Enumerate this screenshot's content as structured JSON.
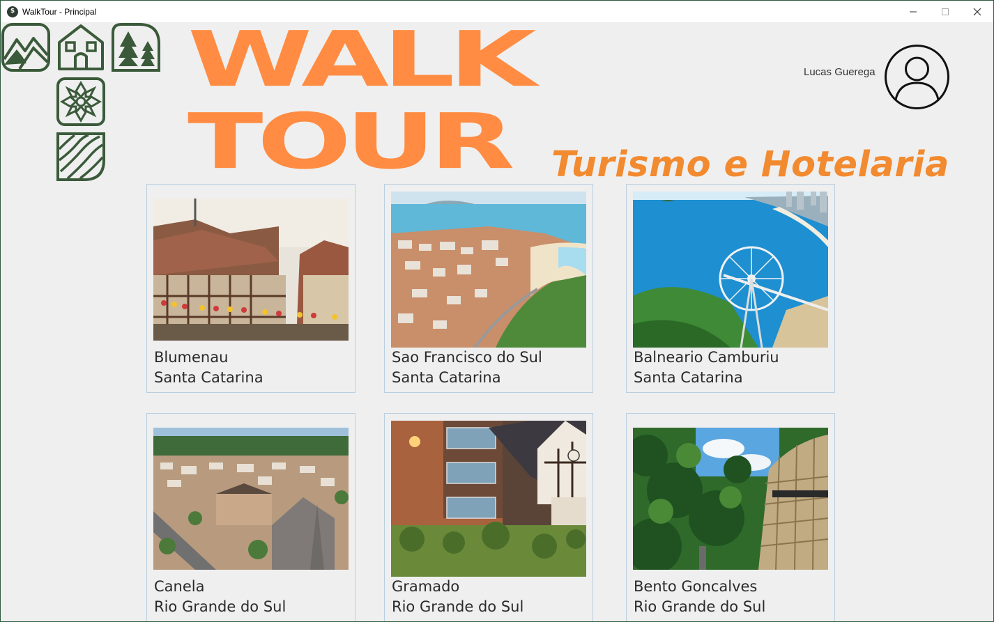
{
  "window": {
    "title": "WalkTour - Principal",
    "icon_glyph": "$",
    "controls": [
      "minimize-icon",
      "maximize-icon",
      "close-icon"
    ]
  },
  "brand": {
    "line1": "WALK",
    "line2": "TOUR",
    "tagline": "Turismo e Hotelaria",
    "accent_color": "#ff8c42",
    "logo_color": "#3b5a3a",
    "logo_icons": [
      "mountain-icon",
      "house-icon",
      "pine-trees-icon",
      "snowflake-icon",
      "waves-icon"
    ]
  },
  "user": {
    "name": "Lucas Guerega",
    "avatar_icon": "user-avatar-icon"
  },
  "destinations": [
    {
      "city": "Blumenau",
      "state": "Santa Catarina",
      "photo": "half-timbered-houses"
    },
    {
      "city": "Sao Francisco do Sul",
      "state": "Santa Catarina",
      "photo": "coastal-town-aerial"
    },
    {
      "city": "Balneario Camburiu",
      "state": "Santa Catarina",
      "photo": "ferris-wheel-coast"
    },
    {
      "city": "Canela",
      "state": "Rio Grande do Sul",
      "photo": "cathedral-town-aerial"
    },
    {
      "city": "Gramado",
      "state": "Rio Grande do Sul",
      "photo": "alpine-street-evening"
    },
    {
      "city": "Bento Goncalves",
      "state": "Rio Grande do Sul",
      "photo": "wine-barrel-tower-forest"
    }
  ]
}
